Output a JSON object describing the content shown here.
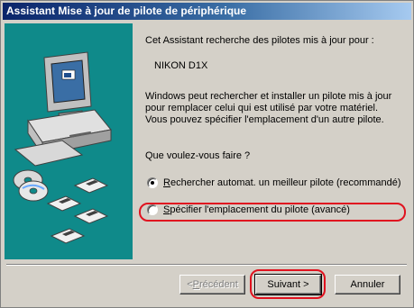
{
  "window": {
    "title": "Assistant Mise à jour de pilote de périphérique"
  },
  "content": {
    "intro": "Cet Assistant recherche des pilotes mis à jour pour :",
    "device_name": "NIKON D1X",
    "description": "Windows peut rechercher et installer un pilote mis à jour pour remplacer celui qui est utilisé par votre matériel. Vous pouvez spécifier l'emplacement d'un autre pilote.",
    "question": "Que voulez-vous faire ?"
  },
  "options": [
    {
      "accel": "R",
      "rest": "echercher automat. un meilleur pilote (recommandé)",
      "selected": true
    },
    {
      "accel": "S",
      "rest": "pécifier l'emplacement du pilote (avancé)",
      "selected": false
    }
  ],
  "buttons": {
    "back_prefix": "< ",
    "back_accel": "P",
    "back_rest": "récédent",
    "next_label": "Suivant >",
    "cancel_label": "Annuler"
  },
  "colors": {
    "title_gradient_start": "#0a246a",
    "title_gradient_end": "#a6caf0",
    "banner": "#0f8a8a",
    "highlight": "#e0121f"
  },
  "banner_icons": [
    "computer-icon",
    "monitor-icon",
    "cd-disc-icon",
    "floppy-disk-icon"
  ]
}
